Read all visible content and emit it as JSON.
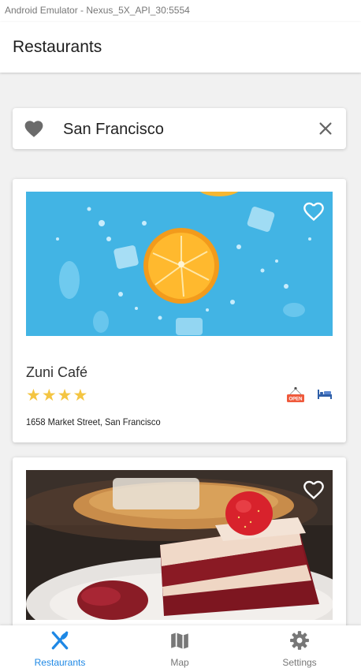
{
  "window": {
    "title": "Android Emulator - Nexus_5X_API_30:5554"
  },
  "appbar": {
    "title": "Restaurants"
  },
  "search": {
    "value": "San Francisco",
    "icon": "heart-icon",
    "clear_icon": "close-icon"
  },
  "restaurants": [
    {
      "name": "Zuni Café",
      "rating": 4,
      "stars": "★★★★",
      "address": "1658 Market Street, San Francisco",
      "badges": [
        "open-sign-icon",
        "bed-icon"
      ],
      "image": "orange slices on blue background"
    },
    {
      "image": "red velvet cake with strawberry"
    }
  ],
  "nav": {
    "items": [
      {
        "label": "Restaurants",
        "icon": "utensils-icon",
        "active": true
      },
      {
        "label": "Map",
        "icon": "map-icon",
        "active": false
      },
      {
        "label": "Settings",
        "icon": "gear-icon",
        "active": false
      }
    ]
  },
  "colors": {
    "accent": "#1e88e5",
    "star": "#f4c542",
    "nav_inactive": "#777777"
  }
}
